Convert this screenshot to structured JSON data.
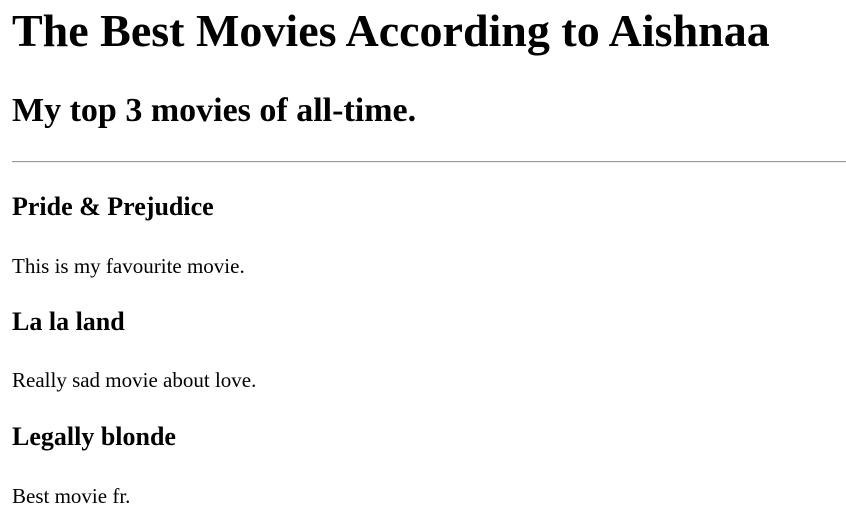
{
  "page": {
    "title": "The Best Movies According to Aishnaa",
    "subtitle": "My top 3 movies of all-time."
  },
  "movies": [
    {
      "title": "Pride & Prejudice",
      "description": "This is my favourite movie."
    },
    {
      "title": "La la land",
      "description": "Really sad movie about love."
    },
    {
      "title": "Legally blonde",
      "description": "Best movie fr."
    }
  ]
}
